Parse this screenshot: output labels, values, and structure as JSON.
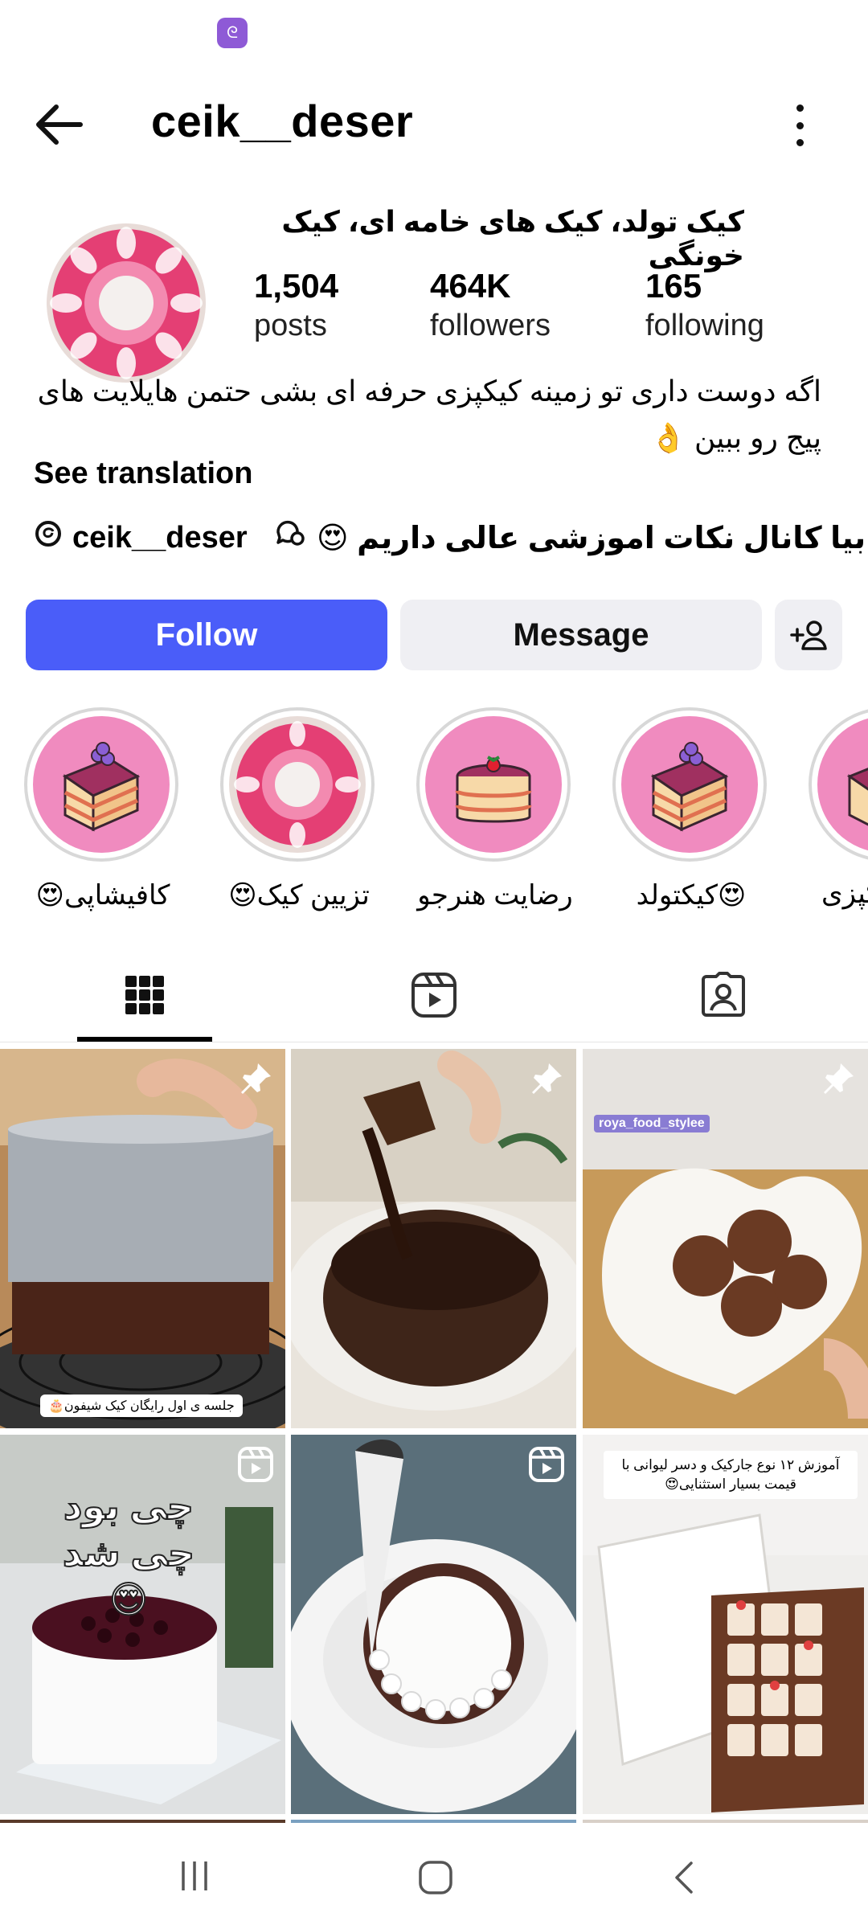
{
  "header": {
    "username": "ceik__deser"
  },
  "profile": {
    "full_name": "کیک تولد، کیک های خامه ای، کیک خونگی",
    "stats": [
      {
        "value": "1,504",
        "label": "posts"
      },
      {
        "value": "464K",
        "label": "followers"
      },
      {
        "value": "165",
        "label": "following"
      }
    ],
    "bio_line1": "اگه دوست داری تو زمینه کیکپزی حرفه ای بشی حتمن هایلایت  های",
    "bio_line2": "پیج رو ببین 👌",
    "see_translation": "See translation",
    "threads_handle": "ceik__deser",
    "channel_text": "بیا کانال نکات اموزشی عالی داریم 😍"
  },
  "actions": {
    "follow_label": "Follow",
    "message_label": "Message"
  },
  "highlights": [
    {
      "label": "کافیشاپی😍",
      "icon": "cake-slice-icon"
    },
    {
      "label": "تزیین کیک😍",
      "icon": "ring-cake-icon"
    },
    {
      "label": "رضایت هنرجو",
      "icon": "strawberry-cake-icon"
    },
    {
      "label": "😍کیکتولد",
      "icon": "cake-slice-icon"
    },
    {
      "label": "کیکپزی",
      "icon": "cake-slice-icon"
    }
  ],
  "tabs": [
    {
      "name": "grid-icon",
      "active": true
    },
    {
      "name": "reels-icon",
      "active": false
    },
    {
      "name": "tagged-icon",
      "active": false
    }
  ],
  "posts": [
    {
      "badge": "pin-icon",
      "caption": "جلسه ی اول رایگان کیک شیفون🎂"
    },
    {
      "badge": "pin-icon",
      "caption": ""
    },
    {
      "badge": "pin-icon",
      "caption": "roya_food_stylee"
    },
    {
      "badge": "reel-icon",
      "caption": "چی بود چی شد 😍"
    },
    {
      "badge": "reel-icon",
      "caption": ""
    },
    {
      "badge": "reel-icon",
      "caption": "آموزش ۱۲ نوع جارکیک و دسر لیوانی با قیمت بسیار استثنایی😍"
    }
  ],
  "colors": {
    "follow": "#4a5df9",
    "secondary_button": "#efeff3",
    "status_icon": "#8e5ad6"
  }
}
